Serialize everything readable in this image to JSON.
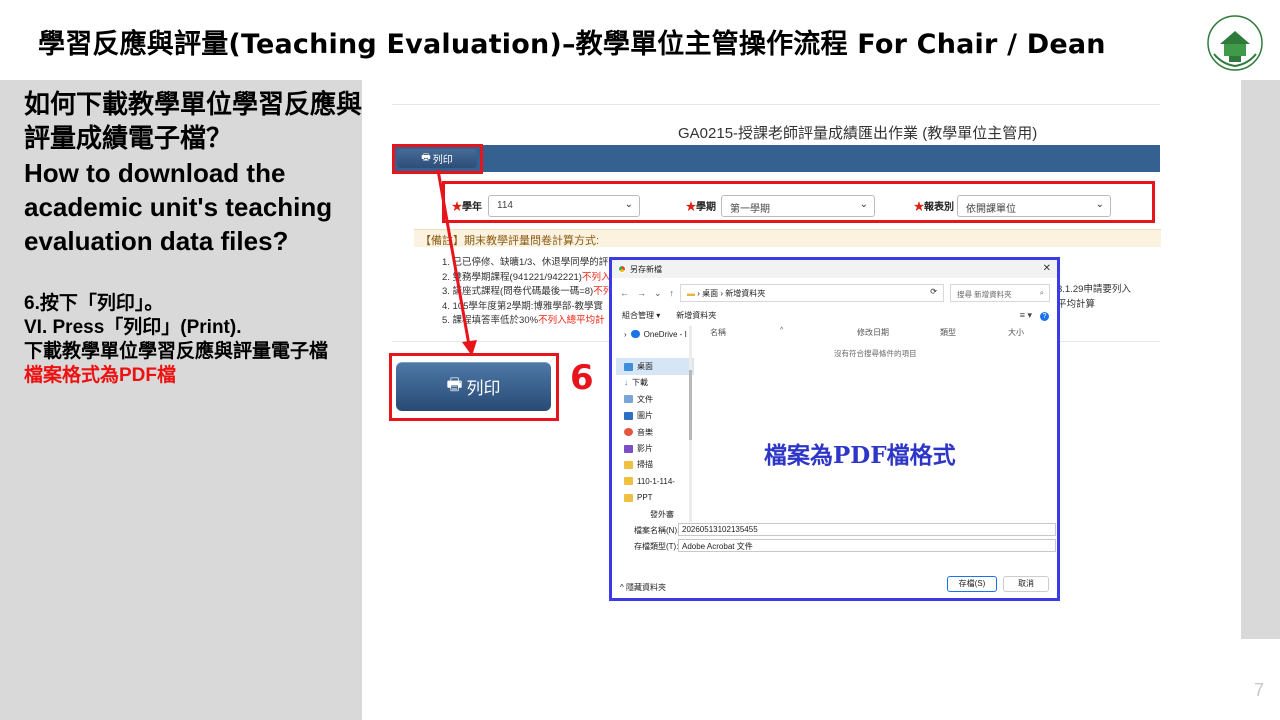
{
  "slide": {
    "title": "學習反應與評量(Teaching Evaluation)–教學單位主管操作流程 For Chair / Dean",
    "page_number": "7"
  },
  "left": {
    "question_zh": "如何下載教學單位學習反應與評量成績電子檔？",
    "question_en": "How to download the academic unit's teaching evaluation data files?",
    "step_zh": "6.按下「列印」。",
    "step_en": "VI. Press「列印」(Print).",
    "step_desc": "下載教學單位學習反應與評量電子檔",
    "step_note": "檔案格式為PDF檔"
  },
  "screenshot": {
    "page_title": "GA0215-授課老師評量成績匯出作業 (教學單位主管用)",
    "print_label": "列印",
    "filters": [
      {
        "label": "學年",
        "value": "114"
      },
      {
        "label": "學期",
        "value": "第一學期"
      },
      {
        "label": "報表別",
        "value": "依開課單位"
      }
    ],
    "note_header": "【備註】期末教學評量問卷計算方式:",
    "notes": [
      {
        "text": "1. 已已停修、缺曠1/3、休退學同學的評",
        "red": ""
      },
      {
        "text": "2. 雙務學期課程(941221/942221)",
        "red": "不列入"
      },
      {
        "text": "3. 講座式課程(問卷代碼最後一碼=8)",
        "red": "不列"
      },
      {
        "text": "4. 105學年度第2學期:博雅學部-教學實",
        "red": ""
      },
      {
        "text": "5. 課程填答率低於30%",
        "red": "不列入總平均計"
      }
    ],
    "notes_right": [
      "3.1.29申請要列入",
      "平均計算"
    ],
    "step_number": "6"
  },
  "dialog": {
    "title": "另存新檔",
    "address_path": "桌面 › 新增資料夾",
    "search_placeholder": "搜尋 新增資料夾",
    "organize": "組合管理 ▾",
    "new_folder": "新增資料夾",
    "nav_items": [
      "OneDrive - I",
      "桌面",
      "下載",
      "文件",
      "圖片",
      "音樂",
      "影片",
      "掃描",
      "110-1-114-",
      "PPT",
      "發外審"
    ],
    "col_name": "名稱",
    "col_date": "修改日期",
    "col_type": "類型",
    "col_size": "大小",
    "empty_message": "沒有符合搜尋條件的項目",
    "big_note": "檔案為PDF檔格式",
    "filename_label": "檔案名稱(N):",
    "filename_value": "20260513102135455",
    "filetype_label": "存檔類型(T):",
    "filetype_value": "Adobe Acrobat 文件",
    "hide_folders": "隱藏資料夾",
    "save_button": "存檔(S)",
    "cancel_button": "取消"
  },
  "colors": {
    "accent_red": "#e8141b",
    "dialog_border": "#3a3ae6",
    "navbar_blue": "#34618f",
    "panel_gray": "#d9d9d9"
  }
}
